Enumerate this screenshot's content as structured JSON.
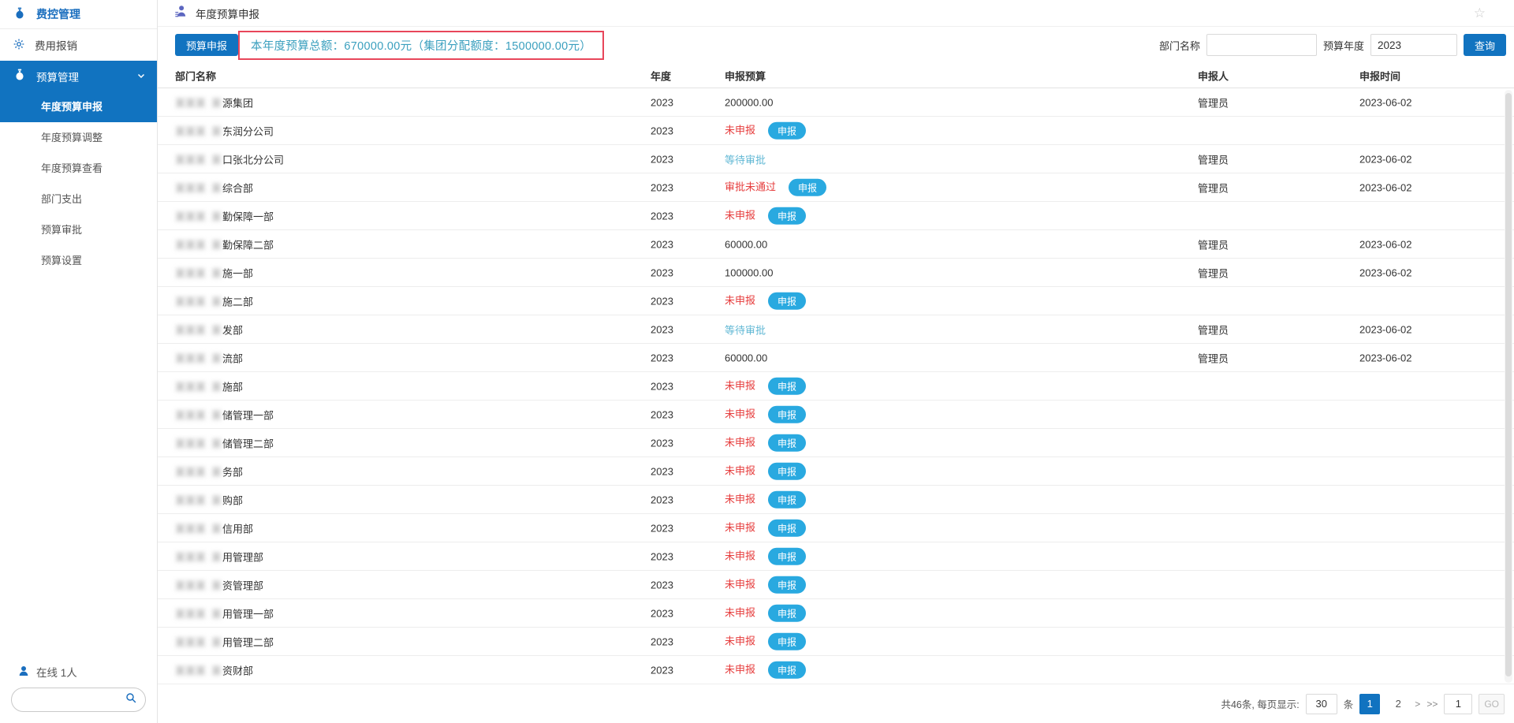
{
  "colors": {
    "accent": "#1173c0",
    "accent_text": "#1a6ebe",
    "pill": "#29a9e0",
    "red_border": "#e8465a",
    "teal": "#3a9fbe",
    "st_red": "#e63c3c",
    "st_blue": "#5fb7d4"
  },
  "icons": {
    "star": "☆"
  },
  "sidebar": {
    "title": "费控管理",
    "items": [
      {
        "label": "费用报销"
      },
      {
        "label": "预算管理"
      }
    ],
    "submenu": [
      "年度预算申报",
      "年度预算调整",
      "年度预算查看",
      "部门支出",
      "预算审批",
      "预算设置"
    ],
    "online_text": "在线 1人"
  },
  "header": {
    "title": "年度预算申报"
  },
  "toolbar": {
    "declare_button": "预算申报",
    "summary": "本年度预算总额：670000.00元（集团分配额度：1500000.00元）",
    "dept_label": "部门名称",
    "dept_value": "",
    "year_label": "预算年度",
    "year_value": "2023",
    "search_button": "查询"
  },
  "table": {
    "columns": [
      "部门名称",
      "年度",
      "申报预算",
      "申报人",
      "申报时间"
    ],
    "declare_label": "申报",
    "redacted": {
      "blob1": "某某某",
      "blob2": "某"
    },
    "rows": [
      {
        "dept": "源集团",
        "year": "2023",
        "budget": "200000.00",
        "status": null,
        "declare": false,
        "by": "管理员",
        "time": "2023-06-02"
      },
      {
        "dept": "东润分公司",
        "year": "2023",
        "budget": null,
        "status": "未申报",
        "declare": true,
        "by": "",
        "time": ""
      },
      {
        "dept": "口张北分公司",
        "year": "2023",
        "budget": null,
        "status": "等待审批",
        "declare": false,
        "by": "管理员",
        "time": "2023-06-02"
      },
      {
        "dept": "综合部",
        "year": "2023",
        "budget": null,
        "status": "审批未通过",
        "declare": true,
        "by": "管理员",
        "time": "2023-06-02"
      },
      {
        "dept": "勤保障一部",
        "year": "2023",
        "budget": null,
        "status": "未申报",
        "declare": true,
        "by": "",
        "time": ""
      },
      {
        "dept": "勤保障二部",
        "year": "2023",
        "budget": "60000.00",
        "status": null,
        "declare": false,
        "by": "管理员",
        "time": "2023-06-02"
      },
      {
        "dept": "施一部",
        "year": "2023",
        "budget": "100000.00",
        "status": null,
        "declare": false,
        "by": "管理员",
        "time": "2023-06-02"
      },
      {
        "dept": "施二部",
        "year": "2023",
        "budget": null,
        "status": "未申报",
        "declare": true,
        "by": "",
        "time": ""
      },
      {
        "dept": "发部",
        "year": "2023",
        "budget": null,
        "status": "等待审批",
        "declare": false,
        "by": "管理员",
        "time": "2023-06-02"
      },
      {
        "dept": "流部",
        "year": "2023",
        "budget": "60000.00",
        "status": null,
        "declare": false,
        "by": "管理员",
        "time": "2023-06-02"
      },
      {
        "dept": "施部",
        "year": "2023",
        "budget": null,
        "status": "未申报",
        "declare": true,
        "by": "",
        "time": ""
      },
      {
        "dept": "储管理一部",
        "year": "2023",
        "budget": null,
        "status": "未申报",
        "declare": true,
        "by": "",
        "time": ""
      },
      {
        "dept": "储管理二部",
        "year": "2023",
        "budget": null,
        "status": "未申报",
        "declare": true,
        "by": "",
        "time": ""
      },
      {
        "dept": "务部",
        "year": "2023",
        "budget": null,
        "status": "未申报",
        "declare": true,
        "by": "",
        "time": ""
      },
      {
        "dept": "购部",
        "year": "2023",
        "budget": null,
        "status": "未申报",
        "declare": true,
        "by": "",
        "time": ""
      },
      {
        "dept": "信用部",
        "year": "2023",
        "budget": null,
        "status": "未申报",
        "declare": true,
        "by": "",
        "time": ""
      },
      {
        "dept": "用管理部",
        "year": "2023",
        "budget": null,
        "status": "未申报",
        "declare": true,
        "by": "",
        "time": ""
      },
      {
        "dept": "资管理部",
        "year": "2023",
        "budget": null,
        "status": "未申报",
        "declare": true,
        "by": "",
        "time": ""
      },
      {
        "dept": "用管理一部",
        "year": "2023",
        "budget": null,
        "status": "未申报",
        "declare": true,
        "by": "",
        "time": ""
      },
      {
        "dept": "用管理二部",
        "year": "2023",
        "budget": null,
        "status": "未申报",
        "declare": true,
        "by": "",
        "time": ""
      },
      {
        "dept": "资财部",
        "year": "2023",
        "budget": null,
        "status": "未申报",
        "declare": true,
        "by": "",
        "time": ""
      }
    ]
  },
  "pagination": {
    "total_text": "共46条, 每页显示:",
    "page_size": "30",
    "unit": "条",
    "pages": [
      "1",
      "2"
    ],
    "next": ">",
    "last": ">>",
    "goto_value": "1",
    "go_label": "GO"
  }
}
